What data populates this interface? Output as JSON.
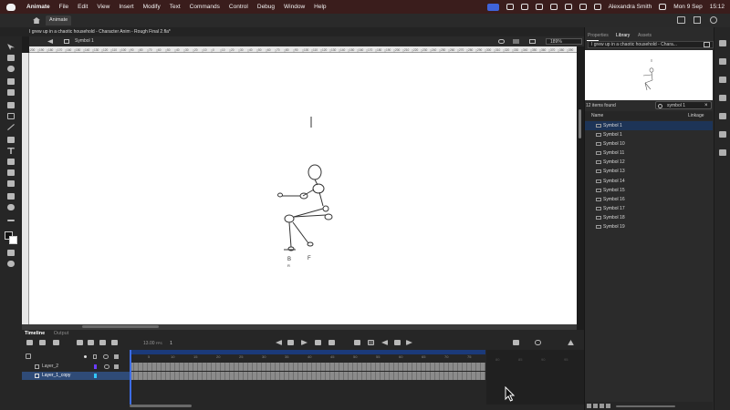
{
  "menubar": {
    "app_name": "Animate",
    "menus": [
      "File",
      "Edit",
      "View",
      "Insert",
      "Modify",
      "Text",
      "Commands",
      "Control",
      "Debug",
      "Window",
      "Help"
    ],
    "user": "Alexandra Smith",
    "date": "Mon 9 Sep",
    "time": "15:12"
  },
  "app_tab": {
    "label": "Animate"
  },
  "document": {
    "title": "I grew up in a chaotic household - Character Anim - Rough Final 2.fla*",
    "symbol_breadcrumb": "Symbol 1",
    "zoom": "189%"
  },
  "ruler": {
    "h_ticks": [
      "200",
      "190",
      "180",
      "170",
      "160",
      "150",
      "140",
      "130",
      "120",
      "110",
      "100",
      "90",
      "80",
      "70",
      "60",
      "50",
      "40",
      "30",
      "20",
      "10",
      "0",
      "10",
      "20",
      "30",
      "40",
      "50",
      "60",
      "70",
      "80",
      "90",
      "100",
      "110",
      "120",
      "130",
      "140",
      "150",
      "160",
      "170",
      "180",
      "190",
      "200",
      "210",
      "220",
      "230",
      "240",
      "250",
      "260",
      "270",
      "280",
      "290",
      "300",
      "310",
      "320",
      "330",
      "340",
      "350",
      "360",
      "370",
      "380",
      "390"
    ]
  },
  "drawing": {
    "labels": [
      "B",
      "F"
    ],
    "sub_label": "R"
  },
  "right_panel": {
    "tabs": [
      "Properties",
      "Library",
      "Assets"
    ],
    "active_tab": "Library",
    "document_select": "I grew up in a chaotic household - Chara...",
    "items_found": "12 items found",
    "search_value": "symbol 1",
    "columns": [
      "Name",
      "Linkage"
    ],
    "items": [
      "Symbol 1",
      "Symbol 1",
      "Symbol 10",
      "Symbol 11",
      "Symbol 12",
      "Symbol 13",
      "Symbol 14",
      "Symbol 15",
      "Symbol 16",
      "Symbol 17",
      "Symbol 18",
      "Symbol 19"
    ]
  },
  "timeline": {
    "tabs": [
      "Timeline",
      "Output"
    ],
    "fps": "13.00",
    "fps_unit": "FPS",
    "frame": "1",
    "frame_numbers": [
      "5",
      "10",
      "15",
      "20",
      "25",
      "30",
      "35",
      "40",
      "45",
      "50",
      "55",
      "60",
      "65",
      "70",
      "75"
    ],
    "layers": [
      "Layer_2",
      "Layer_1_copy"
    ],
    "selected_layer": "Layer_1_copy",
    "right_numbers": [
      "80",
      "85",
      "90",
      "95"
    ]
  },
  "colors": {
    "menubar_bg": "#3a1d1c",
    "selection_blue": "#2f4b77",
    "playhead": "#3d6de6",
    "layer1_color": "#6b3cff",
    "layer2_color": "#33c8ff"
  }
}
